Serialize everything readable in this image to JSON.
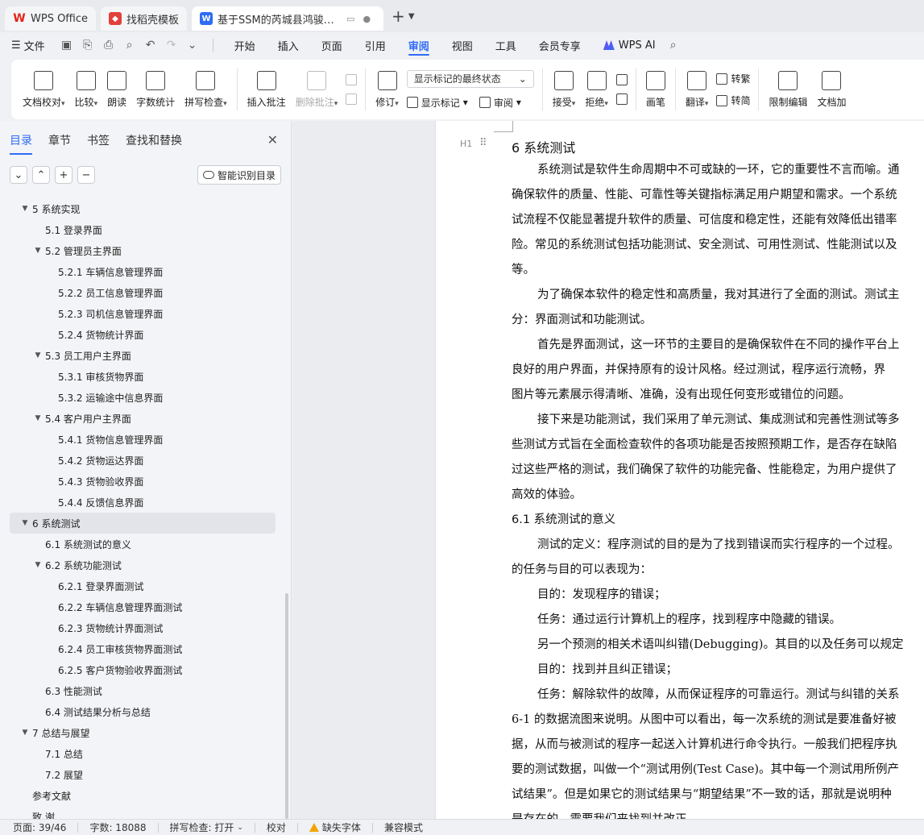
{
  "tabs": [
    {
      "label": "WPS Office",
      "icon": "wps-logo-icon"
    },
    {
      "label": "找稻壳模板",
      "icon": "template-logo-icon"
    },
    {
      "label": "基于SSM的芮城县鸿骏物流管",
      "icon": "doc-logo-icon"
    }
  ],
  "menubar": {
    "file": "文件",
    "tabs": [
      "开始",
      "插入",
      "页面",
      "引用",
      "审阅",
      "视图",
      "工具",
      "会员专享"
    ],
    "active_tab": "审阅",
    "wps_ai": "WPS AI"
  },
  "ribbon": {
    "proofread": "文档校对",
    "compare": "比较",
    "read_aloud": "朗读",
    "word_count": "字数统计",
    "spell_check": "拼写检查",
    "insert_comment": "插入批注",
    "delete_comment": "删除批注",
    "revise": "修订",
    "markup_state": "显示标记的最终状态",
    "show_markup": "显示标记",
    "review": "审阅",
    "accept": "接受",
    "reject": "拒绝",
    "pen": "画笔",
    "translate": "翻译",
    "to_traditional": "转繁",
    "to_simplified": "转简",
    "restrict_edit": "限制编辑",
    "doc_encrypt": "文档加"
  },
  "nav": {
    "tabs": [
      "目录",
      "章节",
      "书签",
      "查找和替换"
    ],
    "active_tab": "目录",
    "smart_toc": "智能识别目录",
    "toc": [
      {
        "text": "5 系统实现",
        "level": 1,
        "arrow": true
      },
      {
        "text": "5.1 登录界面",
        "level": 2,
        "arrow": false
      },
      {
        "text": "5.2  管理员主界面",
        "level": 2,
        "arrow": true
      },
      {
        "text": "5.2.1 车辆信息管理界面",
        "level": 3,
        "arrow": false
      },
      {
        "text": "5.2.2 员工信息管理界面",
        "level": 3,
        "arrow": false
      },
      {
        "text": "5.2.3 司机信息管理界面",
        "level": 3,
        "arrow": false
      },
      {
        "text": "5.2.4 货物统计界面",
        "level": 3,
        "arrow": false
      },
      {
        "text": "5.3  员工用户主界面",
        "level": 2,
        "arrow": true
      },
      {
        "text": "5.3.1  审核货物界面",
        "level": 3,
        "arrow": false
      },
      {
        "text": "5.3.2  运输途中信息界面",
        "level": 3,
        "arrow": false
      },
      {
        "text": "5.4  客户用户主界面",
        "level": 2,
        "arrow": true
      },
      {
        "text": "5.4.1  货物信息管理界面",
        "level": 3,
        "arrow": false
      },
      {
        "text": "5.4.2  货物运达界面",
        "level": 3,
        "arrow": false
      },
      {
        "text": "5.4.3  货物验收界面",
        "level": 3,
        "arrow": false
      },
      {
        "text": "5.4.4  反馈信息界面",
        "level": 3,
        "arrow": false
      },
      {
        "text": "6 系统测试",
        "level": 1,
        "arrow": true,
        "selected": true
      },
      {
        "text": "6.1 系统测试的意义",
        "level": 2,
        "arrow": false
      },
      {
        "text": "6.2  系统功能测试",
        "level": 2,
        "arrow": true
      },
      {
        "text": "6.2.1 登录界面测试",
        "level": 3,
        "arrow": false
      },
      {
        "text": "6.2.2  车辆信息管理界面测试",
        "level": 3,
        "arrow": false
      },
      {
        "text": "6.2.3  货物统计界面测试",
        "level": 3,
        "arrow": false
      },
      {
        "text": "6.2.4 员工审核货物界面测试",
        "level": 3,
        "arrow": false
      },
      {
        "text": "6.2.5  客户货物验收界面测试",
        "level": 3,
        "arrow": false
      },
      {
        "text": "6.3  性能测试",
        "level": 2,
        "arrow": false
      },
      {
        "text": "6.4  测试结果分析与总结",
        "level": 2,
        "arrow": false
      },
      {
        "text": "7 总结与展望",
        "level": 1,
        "arrow": true
      },
      {
        "text": "7.1  总结",
        "level": 2,
        "arrow": false
      },
      {
        "text": "7.2  展望",
        "level": 2,
        "arrow": false
      },
      {
        "text": "参考文献",
        "level": 1,
        "arrow": false
      },
      {
        "text": "致   谢",
        "level": 1,
        "arrow": false
      }
    ]
  },
  "doc": {
    "heading_mark": "H1",
    "lines": [
      {
        "type": "h1",
        "text": "6 系统测试"
      },
      {
        "type": "ind",
        "text": "系统测试是软件生命周期中不可或缺的一环，它的重要性不言而喻。通"
      },
      {
        "type": "ln",
        "text": "确保软件的质量、性能、可靠性等关键指标满足用户期望和需求。一个系统"
      },
      {
        "type": "ln",
        "text": "试流程不仅能显著提升软件的质量、可信度和稳定性，还能有效降低出错率"
      },
      {
        "type": "ln",
        "text": "险。常见的系统测试包括功能测试、安全测试、可用性测试、性能测试以及"
      },
      {
        "type": "ln",
        "text": "等。"
      },
      {
        "type": "ind",
        "text": "为了确保本软件的稳定性和高质量，我对其进行了全面的测试。测试主"
      },
      {
        "type": "ln",
        "text": "分：界面测试和功能测试。"
      },
      {
        "type": "ind",
        "text": "首先是界面测试，这一环节的主要目的是确保软件在不同的操作平台上"
      },
      {
        "type": "ln",
        "text": "良好的用户界面，并保持原有的设计风格。经过测试，程序运行流畅，界"
      },
      {
        "type": "ln",
        "text": "图片等元素展示得清晰、准确，没有出现任何变形或错位的问题。"
      },
      {
        "type": "ind",
        "text": "接下来是功能测试，我们采用了单元测试、集成测试和完善性测试等多"
      },
      {
        "type": "ln",
        "text": "些测试方式旨在全面检查软件的各项功能是否按照预期工作，是否存在缺陷"
      },
      {
        "type": "ln",
        "text": "过这些严格的测试，我们确保了软件的功能完备、性能稳定，为用户提供了"
      },
      {
        "type": "ln",
        "text": "高效的体验。"
      },
      {
        "type": "h2",
        "text": "6.1 系统测试的意义"
      },
      {
        "type": "ind",
        "text": "测试的定义：程序测试的目的是为了找到错误而实行程序的一个过程。"
      },
      {
        "type": "ln",
        "text": "的任务与目的可以表现为："
      },
      {
        "type": "ind",
        "text": "目的：发现程序的错误；"
      },
      {
        "type": "ind",
        "text": "任务：通过运行计算机上的程序，找到程序中隐藏的错误。"
      },
      {
        "type": "ind",
        "text": "另一个预测的相关术语叫纠错(Debugging)。其目的以及任务可以规定"
      },
      {
        "type": "ind",
        "text": "目的：找到并且纠正错误；"
      },
      {
        "type": "ind",
        "text": "任务：解除软件的故障，从而保证程序的可靠运行。测试与纠错的关系"
      },
      {
        "type": "ln",
        "text": "6-1 的数据流图来说明。从图中可以看出，每一次系统的测试是要准备好被"
      },
      {
        "type": "ln",
        "text": "据，从而与被测试的程序一起送入计算机进行命令执行。一般我们把程序执"
      },
      {
        "type": "ln",
        "text": "要的测试数据，叫做一个“测试用例(Test Case)。其中每一个测试用所例产"
      },
      {
        "type": "ln",
        "text": "试结果”。但是如果它的测试结果与“期望结果”不一致的话，那就是说明种"
      },
      {
        "type": "ln",
        "text": "是存在的，需要我们来找到并改正。"
      }
    ]
  },
  "status": {
    "page": "页面: 39/46",
    "words": "字数: 18088",
    "spell": "拼写检查: 打开",
    "proof": "校对",
    "missing_font": "缺失字体",
    "compat": "兼容模式"
  }
}
